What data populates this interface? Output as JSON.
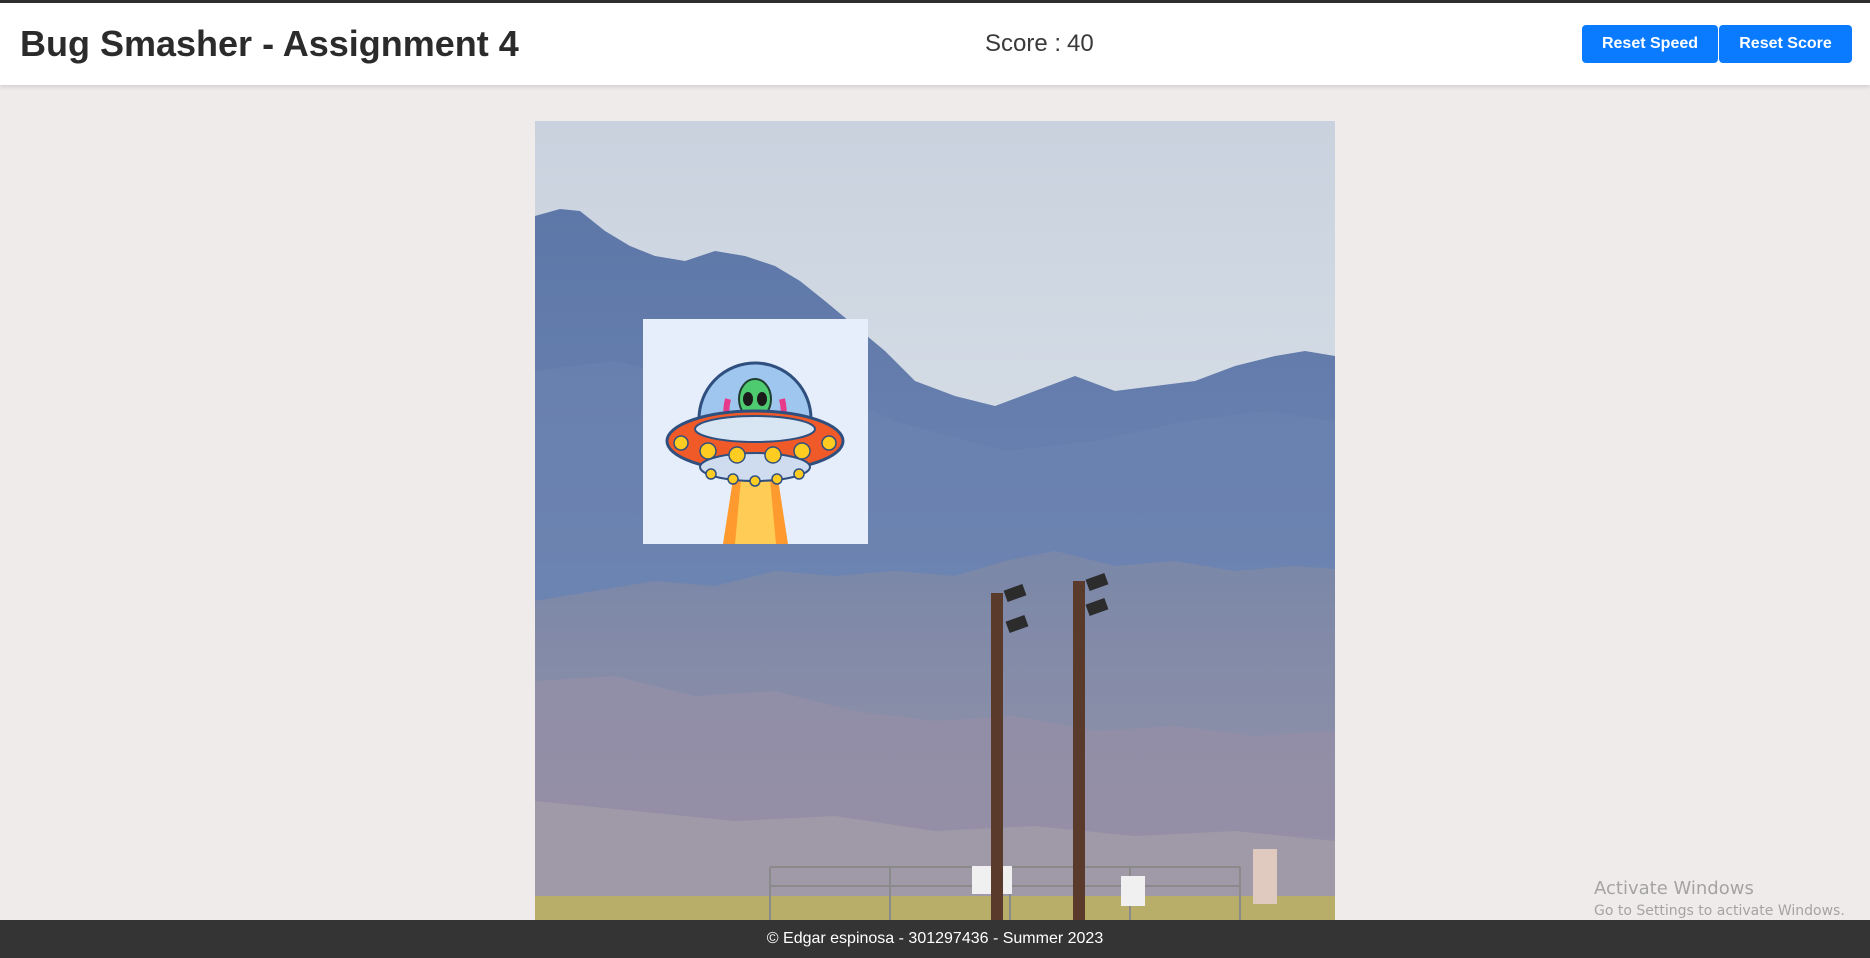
{
  "header": {
    "title": "Bug Smasher - Assignment 4",
    "score_label": "Score :",
    "score_value": "40",
    "reset_speed_label": "Reset Speed",
    "reset_score_label": "Reset Score"
  },
  "game": {
    "background": "mountain-landscape-with-utility-poles",
    "target_icon": "ufo-alien-icon"
  },
  "footer": {
    "text": "© Edgar espinosa - 301297436 - Summer 2023"
  },
  "watermark": {
    "title": "Activate Windows",
    "subtitle": "Go to Settings to activate Windows."
  },
  "colors": {
    "accent": "#0a7bff",
    "header_bg": "#ffffff",
    "page_bg": "#efebeb",
    "footer_bg": "#343434"
  }
}
